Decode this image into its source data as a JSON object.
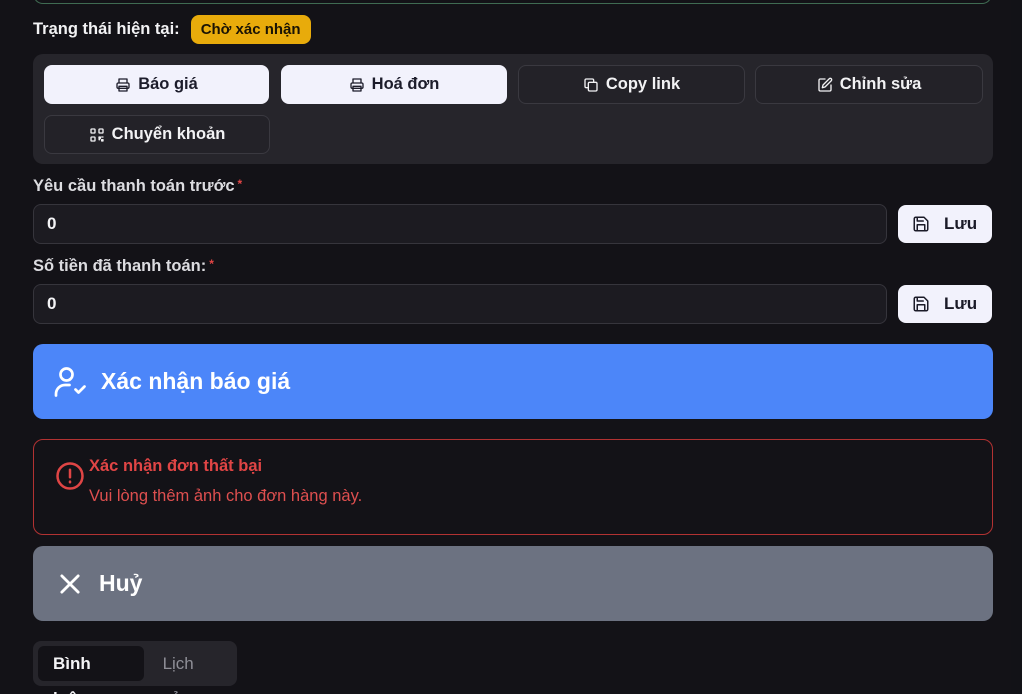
{
  "status": {
    "label": "Trạng thái hiện tại:",
    "badge": "Chờ xác nhận",
    "badge_color": "#e8ab0b"
  },
  "actions": [
    {
      "label": "Báo giá",
      "icon": "printer-icon"
    },
    {
      "label": "Hoá đơn",
      "icon": "printer-icon"
    },
    {
      "label": "Copy link",
      "icon": "copy-icon"
    },
    {
      "label": "Chỉnh sửa",
      "icon": "edit-icon"
    },
    {
      "label": "Chuyển khoản",
      "icon": "qr-code-icon"
    }
  ],
  "fields": [
    {
      "label": "Yêu cầu thanh toán trước",
      "required_mark": "*",
      "value": "0",
      "save_label": "Lưu"
    },
    {
      "label": "Số tiền đã thanh toán:",
      "required_mark": "*",
      "value": "0",
      "save_label": "Lưu"
    }
  ],
  "confirm_button": {
    "label": "Xác nhận báo giá",
    "icon": "user-check-icon",
    "color": "#4c86f9"
  },
  "alert": {
    "title": "Xác nhận đơn thất bại",
    "message": "Vui lòng thêm ảnh cho đơn hàng này.",
    "icon": "alert-circle-icon",
    "color": "#e04545"
  },
  "cancel_button": {
    "label": "Huỷ",
    "icon": "close-icon",
    "color": "#6c7281"
  },
  "tabs": [
    {
      "label": "Bình luận",
      "active": true
    },
    {
      "label": "Lịch sử",
      "active": false
    }
  ]
}
